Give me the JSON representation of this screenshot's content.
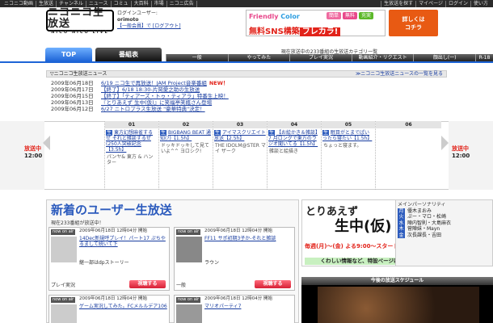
{
  "topbar": {
    "left_links": [
      "ニコニコ動画",
      "生放送",
      "チャンネル",
      "ニュース",
      "コミュ",
      "大百科",
      "市場",
      "ニコニ広告"
    ],
    "right_links": [
      "生放送を探す",
      "マイページ",
      "ログイン",
      "使い方"
    ]
  },
  "header": {
    "logo_text": "ニコニコ生放送",
    "logo_sub": "NICO NICO LIVE",
    "user_label": "ログインユーザー:",
    "user_name": "orimoto",
    "user_links": "【一般会員】で [ログアウト]",
    "ad1_line1_a": "Friendly",
    "ad1_line1_b": "Color",
    "ad1_tags": [
      "簡単",
      "無料",
      "充実"
    ],
    "ad1_line2": "無料SNS構築",
    "ad1_brand": "フレカラ!",
    "ad2_line1": "詳しくは",
    "ad2_line2": "コチラ",
    "right_links": [
      "生放送を探す",
      "マイページ",
      "ログイン",
      "使い方"
    ]
  },
  "nav": {
    "top_tab": "TOP",
    "program_tab": "番組表",
    "category_note": "現在放送中の233番組の生放送カテゴリ一覧",
    "categories": [
      "一般",
      "やってみた",
      "プレイ実況",
      "動画紹介・リクエスト",
      "顔出し(一)",
      "R-18"
    ]
  },
  "news": {
    "title": "▽ニコニコ生放送ニュース",
    "more": "≫ニコニコ生放送ニュースの一覧を見る",
    "items": [
      {
        "date": "2009年06月18日",
        "text": "6/19 ニコ生で再放送！JAM Project音楽番組",
        "new": "NEW！"
      },
      {
        "date": "2009年06月17日",
        "text": "【終了】6/18 18:30-片岡愛之助の生放送",
        "new": ""
      },
      {
        "date": "2009年06月15日",
        "text": "【終了】「ティアーズ・トゥ・ティアラ」特番生上映！",
        "new": ""
      },
      {
        "date": "2009年06月13日",
        "text": "『とりあえず 生中(仮)』に笑福亭笑瓶さん登場",
        "new": ""
      },
      {
        "date": "2009年06月12日",
        "text": "6/27 ニトロプラス生放送 \"豪華特典\"決定！",
        "new": ""
      }
    ]
  },
  "program": {
    "now_label": "放送中",
    "now_time": "12:00",
    "hours": [
      "01",
      "02",
      "03",
      "04",
      "05",
      "06"
    ],
    "items": [
      {
        "tag": "生",
        "title": "東方幻想麻雀するぜ それと雑談するぜ(250人突破記念【3.5h】",
        "desc": "パンヤ& 東方 & ハンター"
      },
      {
        "tag": "生",
        "title": "BIGBANG BEAT 通知(?)【1.5h】",
        "desc": "ドッキドッキして見ていよ^^ ヨロシク!"
      },
      {
        "tag": "生",
        "title": "アイマスクリエイト放送【2.5h】",
        "desc": "THE IDOLM@STER マイ ザーク"
      },
      {
        "tag": "生",
        "title": "【お絵かき＆雑談】7 月ロングで東方のラジオ聞いてる【1.5h】",
        "desc": "雑談と絵描き"
      },
      {
        "tag": "生",
        "title": "眠目がとまでぱいったら寝たい【1.5h】",
        "desc": "ちょっと寝ます。"
      }
    ]
  },
  "users": {
    "title": "新着のユーザー生放送",
    "subtitle": "現在233番組が放送中！",
    "cards": [
      {
        "badge": "now on air",
        "meta": "2009年06月18日 12時04分 開始",
        "title": "14Dec新規呼プレイ！パート17 ぷちやるまして続いて下",
        "comment": "継一部はdpストーリー",
        "category": "プレイ実況",
        "button": "視聴する"
      },
      {
        "badge": "now on air",
        "meta": "2009年06月18日 12時04分 開始",
        "title": "FF11 サポ初期3子か-それと雑談",
        "comment": "ラウン",
        "category": "一般",
        "button": "視聴する"
      },
      {
        "badge": "now on air",
        "meta": "2009年06月18日 12時04分 開始",
        "title": "ゲーム実況してみた。FCメルルデア106",
        "comment": "",
        "category": "",
        "button": ""
      },
      {
        "badge": "now on air",
        "meta": "2009年06月18日 12時04分 開始",
        "title": "マリオパーティ7",
        "comment": "",
        "category": "",
        "button": ""
      }
    ]
  },
  "tori": {
    "title1": "とりあえず",
    "title2": "生中(仮)",
    "time": "毎週(月)～(金) よる9:00～スタート",
    "link": "くわしい情報など、特設ページはこちらから！"
  },
  "personality": {
    "header": "メインパーソナリティ",
    "rows": [
      {
        "day": "月",
        "name": "優木まおみ"
      },
      {
        "day": "火",
        "name": "ぷー・マロ・松崎"
      },
      {
        "day": "水",
        "name": "陣内智則・大島麻衣"
      },
      {
        "day": "木",
        "name": "菅陣妹・Mayn"
      },
      {
        "day": "金",
        "name": "次長課長・吉田"
      }
    ]
  },
  "schedule": {
    "title": "今後の放送スケジュール"
  }
}
